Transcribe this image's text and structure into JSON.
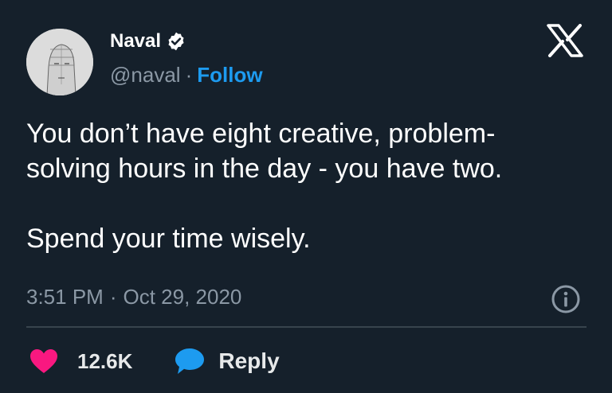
{
  "author": {
    "name": "Naval",
    "handle": "@naval",
    "separator": "·",
    "follow_label": "Follow",
    "verified": true
  },
  "tweet": {
    "text": "You don’t have eight creative, problem-\nsolving hours in the day - you have two.\n\nSpend your time wisely.",
    "time": "3:51 PM",
    "separator": "·",
    "date": "Oct 29, 2020"
  },
  "actions": {
    "like_count": "12.6K",
    "reply_label": "Reply"
  },
  "icons": {
    "platform": "x-logo-icon",
    "info": "info-icon",
    "like": "heart-icon",
    "reply": "speech-bubble-icon"
  },
  "colors": {
    "background": "#15202b",
    "accent": "#1d9bf0",
    "like": "#f91880",
    "muted": "#8b98a5"
  }
}
